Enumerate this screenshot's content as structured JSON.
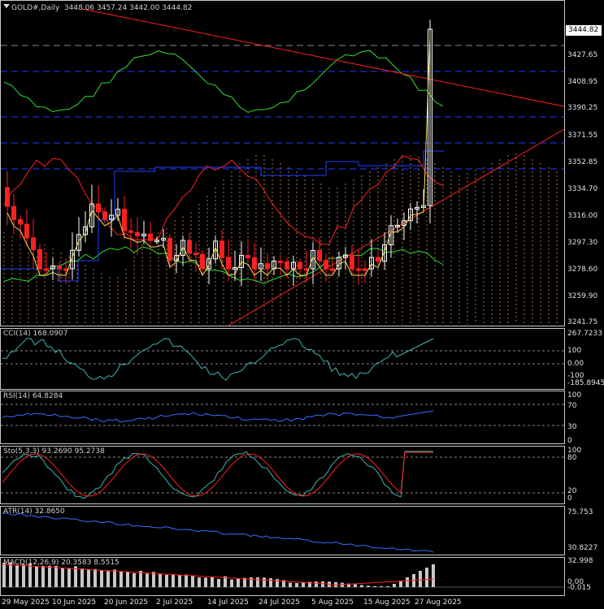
{
  "main_chart": {
    "symbol_label": "GOLD#,Daily",
    "ohlc_text": "3448.06 3457.24 3442.00 3444.82",
    "current_price": "3444.82",
    "price_axis": [
      "3427.65",
      "3408.95",
      "3390.25",
      "3371.55",
      "3352.85",
      "3334.70",
      "3316.00",
      "3297.30",
      "3278.60",
      "3259.90",
      "3241.75"
    ],
    "dropdown_icon": "triangle-down-icon"
  },
  "cci_pane": {
    "label": "CCI(14) 168.0907",
    "axis": [
      "267.7233",
      "100",
      "0.00",
      "-100",
      "-185.8945"
    ]
  },
  "rsi_pane": {
    "label": "RSI(14) 64.8284",
    "axis": [
      "100",
      "70",
      "30",
      "0"
    ]
  },
  "sto_pane": {
    "label": "Sto(5,3,3) 93.2690 95.2738",
    "axis": [
      "100",
      "80",
      "20",
      "0"
    ]
  },
  "atr_pane": {
    "label": "ATR(14) 32.8650",
    "axis": [
      "75.753",
      "30.8227"
    ]
  },
  "macd_pane": {
    "label": "MACD(12,26,9) 20.3583 8.5515",
    "axis": [
      "32.998",
      "0.00",
      "-0.015"
    ]
  },
  "date_axis": [
    "29 May 2025",
    "10 Jun 2025",
    "20 Jun 2025",
    "2 Jul 2025",
    "14 Jul 2025",
    "24 Jul 2025",
    "5 Aug 2025",
    "15 Aug 2025",
    "27 Aug 2025"
  ],
  "colors": {
    "bull_candle": "#ffffff",
    "bear_candle": "#ff2020",
    "trendline": "#ff2020",
    "grid_dash": "#1a3cff",
    "ichimoku_cloud": "#e8a060",
    "bollinger": "#33dd33",
    "cci_line": "#3fb3b3",
    "rsi_line": "#3a6cff",
    "sto_main": "#3fb3b3",
    "sto_signal": "#ff2020",
    "atr_line": "#3a6cff",
    "macd_hist": "#c8c8c8",
    "macd_signal": "#ff2020"
  }
}
